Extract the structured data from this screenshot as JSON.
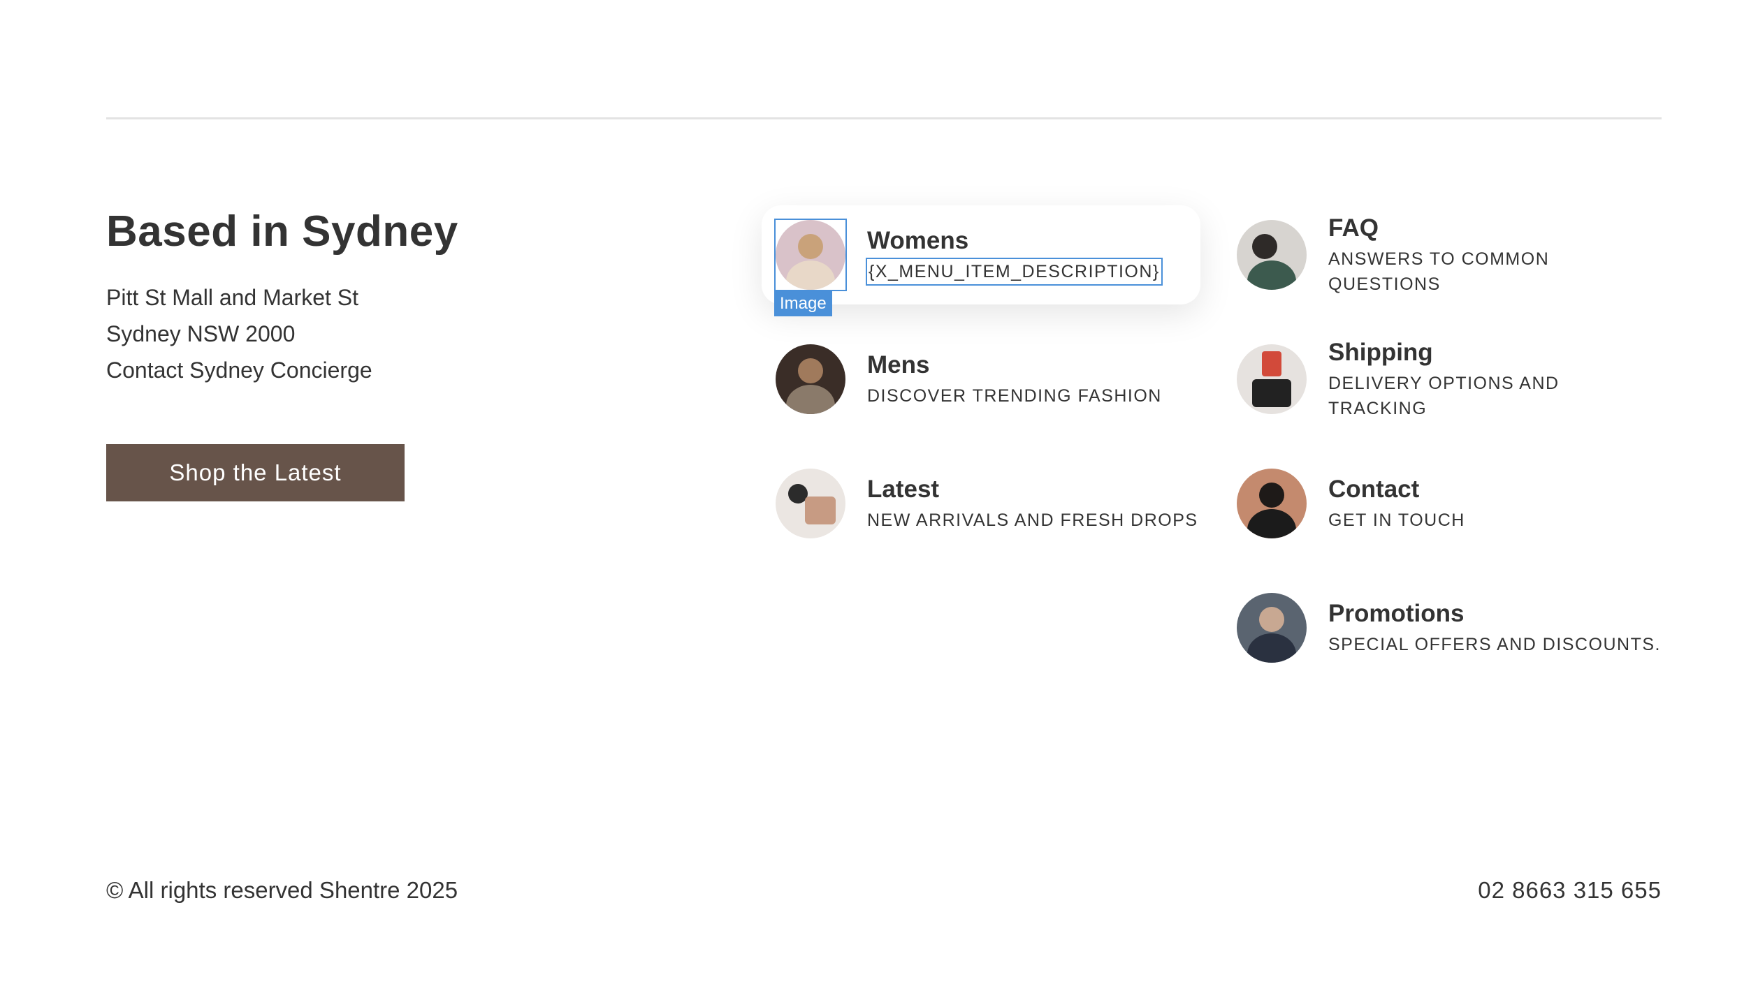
{
  "location": {
    "heading": "Based in Sydney",
    "address_lines": [
      "Pitt St Mall and Market St",
      "Sydney NSW 2000",
      "Contact Sydney Concierge"
    ],
    "cta_label": "Shop the Latest"
  },
  "editor": {
    "image_tag": "Image"
  },
  "menu": {
    "left": [
      {
        "title": "Womens",
        "desc": "{X_MENU_ITEM_DESCRIPTION}",
        "icon": "woman-portrait-icon"
      },
      {
        "title": "Mens",
        "desc": "Discover trending fashion",
        "icon": "man-portrait-icon"
      },
      {
        "title": "Latest",
        "desc": "New arrivals and fresh drops",
        "icon": "accessories-flatlay-icon"
      }
    ],
    "right": [
      {
        "title": "FAQ",
        "desc": "Answers to common questions",
        "icon": "couple-portrait-icon"
      },
      {
        "title": "Shipping",
        "desc": "Delivery options and tracking",
        "icon": "shopping-bags-icon"
      },
      {
        "title": "Contact",
        "desc": "Get in touch",
        "icon": "contact-portrait-icon"
      },
      {
        "title": "Promotions",
        "desc": "Special offers and discounts.",
        "icon": "promo-portrait-icon"
      }
    ]
  },
  "footer": {
    "copyright": "© All rights reserved Shentre 2025",
    "phone": "02 8663 315 655"
  },
  "colors": {
    "button_bg": "#67544a",
    "text": "#333333",
    "divider": "#e3e3e3",
    "selection": "#4a90d9"
  }
}
